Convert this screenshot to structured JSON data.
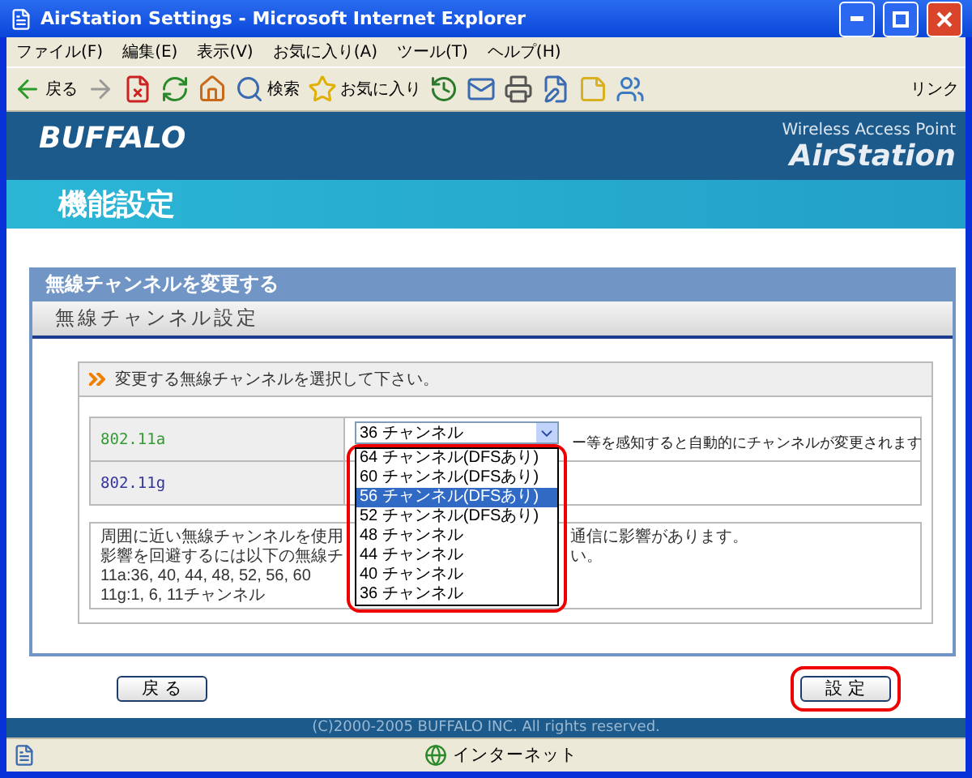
{
  "window": {
    "title": "AirStation Settings - Microsoft Internet Explorer"
  },
  "menu": [
    "ファイル(F)",
    "編集(E)",
    "表示(V)",
    "お気に入り(A)",
    "ツール(T)",
    "ヘルプ(H)"
  ],
  "toolbar": [
    {
      "kind": "back",
      "label": "戻る"
    },
    {
      "kind": "forward"
    },
    {
      "kind": "stop"
    },
    {
      "kind": "refresh"
    },
    {
      "kind": "home"
    },
    {
      "kind": "search",
      "label": "検索"
    },
    {
      "kind": "favorites",
      "label": "お気に入り"
    },
    {
      "kind": "history"
    },
    {
      "kind": "mail"
    },
    {
      "kind": "print"
    },
    {
      "kind": "edit"
    },
    {
      "kind": "note"
    },
    {
      "kind": "messenger"
    }
  ],
  "links": "リンク",
  "header": {
    "brand": "BUFFALO",
    "tagline": "Wireless Access Point",
    "product": "AirStation",
    "page_title": "機能設定"
  },
  "panel": {
    "title": "無線チャンネルを変更する",
    "section": "無線チャンネル設定",
    "instruction": "変更する無線チャンネルを選択して下さい。"
  },
  "rows": [
    {
      "label": "802.11a",
      "color": "#339933",
      "value": "36 チャンネル",
      "note": "ー等を感知すると自動的にチャンネルが変更されます"
    },
    {
      "label": "802.11g",
      "color": "#333399"
    }
  ],
  "dropdown": [
    {
      "label": "64 チャンネル(DFSあり)",
      "selected": false
    },
    {
      "label": "60 チャンネル(DFSあり)",
      "selected": false
    },
    {
      "label": "56 チャンネル(DFSあり)",
      "selected": true
    },
    {
      "label": "52 チャンネル(DFSあり)",
      "selected": false
    },
    {
      "label": "48 チャンネル",
      "selected": false
    },
    {
      "label": "44 チャンネル",
      "selected": false
    },
    {
      "label": "40 チャンネル",
      "selected": false
    },
    {
      "label": "36 チャンネル",
      "selected": false
    }
  ],
  "notes": [
    [
      "周囲に近い無線チャンネルを使用",
      "通信に影響があります。"
    ],
    [
      "影響を回避するには以下の無線チ",
      "い。"
    ],
    [
      "11a:36, 40, 44, 48, 52, 56, 60"
    ],
    [
      "11g:1, 6, 11チャンネル"
    ]
  ],
  "buttons": [
    {
      "label": "戻 る",
      "highlighted": false
    },
    {
      "label": "設 定",
      "highlighted": true
    }
  ],
  "footer": "(C)2000-2005 BUFFALO INC. All rights reserved.",
  "status": {
    "zone": "インターネット"
  }
}
